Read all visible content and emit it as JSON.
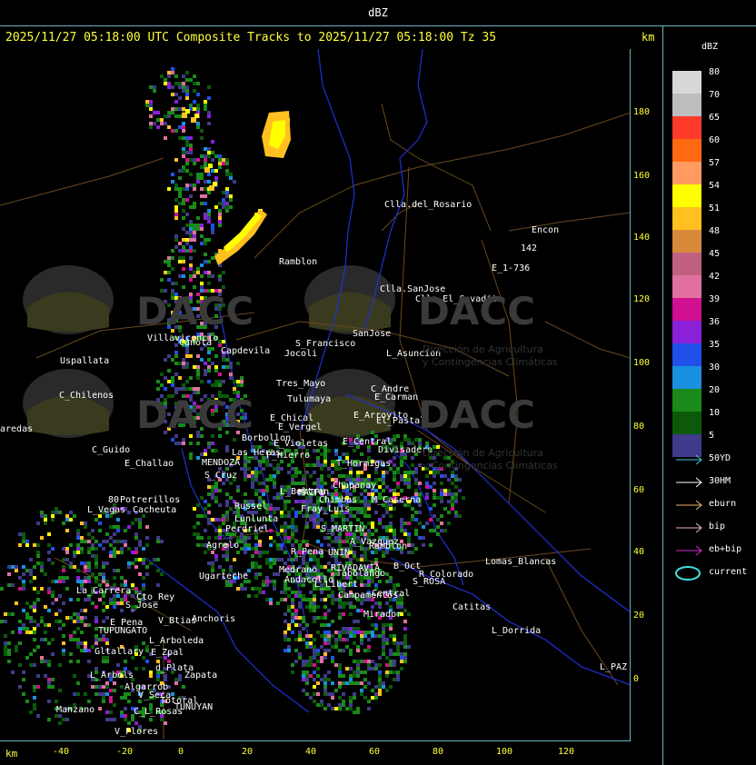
{
  "top_title": "dBZ",
  "header": "2025/11/27 05:18:00 UTC Composite Tracks to 2025/11/27 05:18:00 Tz 35",
  "unit_top": "km",
  "unit_bottom": "km",
  "x_ticks": [
    "-40",
    "-20",
    "0",
    "20",
    "40",
    "60",
    "80",
    "100",
    "120"
  ],
  "y_ticks": [
    "180",
    "160",
    "140",
    "120",
    "100",
    "80",
    "60",
    "40",
    "20",
    "0"
  ],
  "legend": {
    "title": "dBZ",
    "levels": [
      {
        "label": "80",
        "color": "#d8d8d8"
      },
      {
        "label": "70",
        "color": "#bdbdbd"
      },
      {
        "label": "65",
        "color": "#ff3a2a"
      },
      {
        "label": "60",
        "color": "#ff6a10"
      },
      {
        "label": "57",
        "color": "#ff9a60"
      },
      {
        "label": "54",
        "color": "#ffff00"
      },
      {
        "label": "51",
        "color": "#ffc020"
      },
      {
        "label": "48",
        "color": "#d88a3a"
      },
      {
        "label": "45",
        "color": "#c06080"
      },
      {
        "label": "42",
        "color": "#e070a0"
      },
      {
        "label": "39",
        "color": "#d01090"
      },
      {
        "label": "36",
        "color": "#8a20d8"
      },
      {
        "label": "35",
        "color": "#2050e8"
      },
      {
        "label": "30",
        "color": "#1a90e0"
      },
      {
        "label": "20",
        "color": "#1a8a1a"
      },
      {
        "label": "10",
        "color": "#0a5a0a"
      },
      {
        "label": "5",
        "color": "#403a8a"
      }
    ],
    "tracks": [
      {
        "label": "50YD",
        "color": "#40c8d8"
      },
      {
        "label": "30HM",
        "color": "#ffffff"
      },
      {
        "label": "eburn",
        "color": "#e8b070"
      },
      {
        "label": "bip",
        "color": "#f0b0d0"
      },
      {
        "label": "eb+bip",
        "color": "#d030d0"
      },
      {
        "label": "current",
        "color": "#40e0e0"
      }
    ]
  },
  "watermark": {
    "brand": "DACC",
    "line1": "Dirección de Agricultura",
    "line2": "y Contingencias Climáticas"
  },
  "places": [
    "Clla.del_Rosario",
    "Encon",
    "142",
    "E_1-736",
    "Ramblon",
    "Clla.SanJose",
    "Clla.El_Cavadito",
    "Villavicencio",
    "Canota",
    "Capdevila",
    "S_Francisco",
    "Jocoli",
    "SanJose",
    "L_Asuncion",
    "Uspallata",
    "C_Chilenos",
    "Tres_Mayo",
    "Tulumaya",
    "E_Carman",
    "C_Andre",
    "aredas",
    "E_Chical",
    "E_Vergel",
    "E_Arroyito",
    "El_Pastal",
    "Borbollon",
    "E_Violetas",
    "E_Central",
    "Divisadero",
    "C_Guido",
    "E_Challao",
    "MENDOZA",
    "Las_Heras",
    "P_Hierro",
    "T_Hormigas",
    "S_Cruz",
    "Chapanay",
    "Potrerillos",
    "MAIPU",
    "L_Beltran",
    "Chimbas",
    "M_Caserna",
    "Cacheuta",
    "L_Vegas",
    "Russel",
    "Lunlunta",
    "Fray_Luis",
    "Perdriel",
    "S_MARTIN",
    "Agrelo",
    "R_Pena",
    "UNIN",
    "A_Vazquez",
    "Ramblon",
    "Ugarteche",
    "Lomas_Blancas",
    "B_Oct",
    "R_Colorado",
    "Andacollo",
    "Medrano",
    "RIVADAVIA",
    "Tabolango",
    "S_ROSA",
    "La_Carrera",
    "Cto_Rey",
    "S_Jose",
    "L_Libert",
    "Campamentos",
    "Central",
    "Catitas",
    "E_Pena",
    "V_Btias",
    "Anchoris",
    "Mirador",
    "TUPUNGATO",
    "L_Dorrida",
    "L_Arboleda",
    "Gltallary",
    "E_Zpal",
    "d_Plata",
    "L_Arbols",
    "Zapata",
    "L_PAZ",
    "Algarrob",
    "V_Seca",
    "Totoral",
    "TUNUYAN",
    "Manzano",
    "C_L_Rosas",
    "V_Flores",
    "80"
  ]
}
